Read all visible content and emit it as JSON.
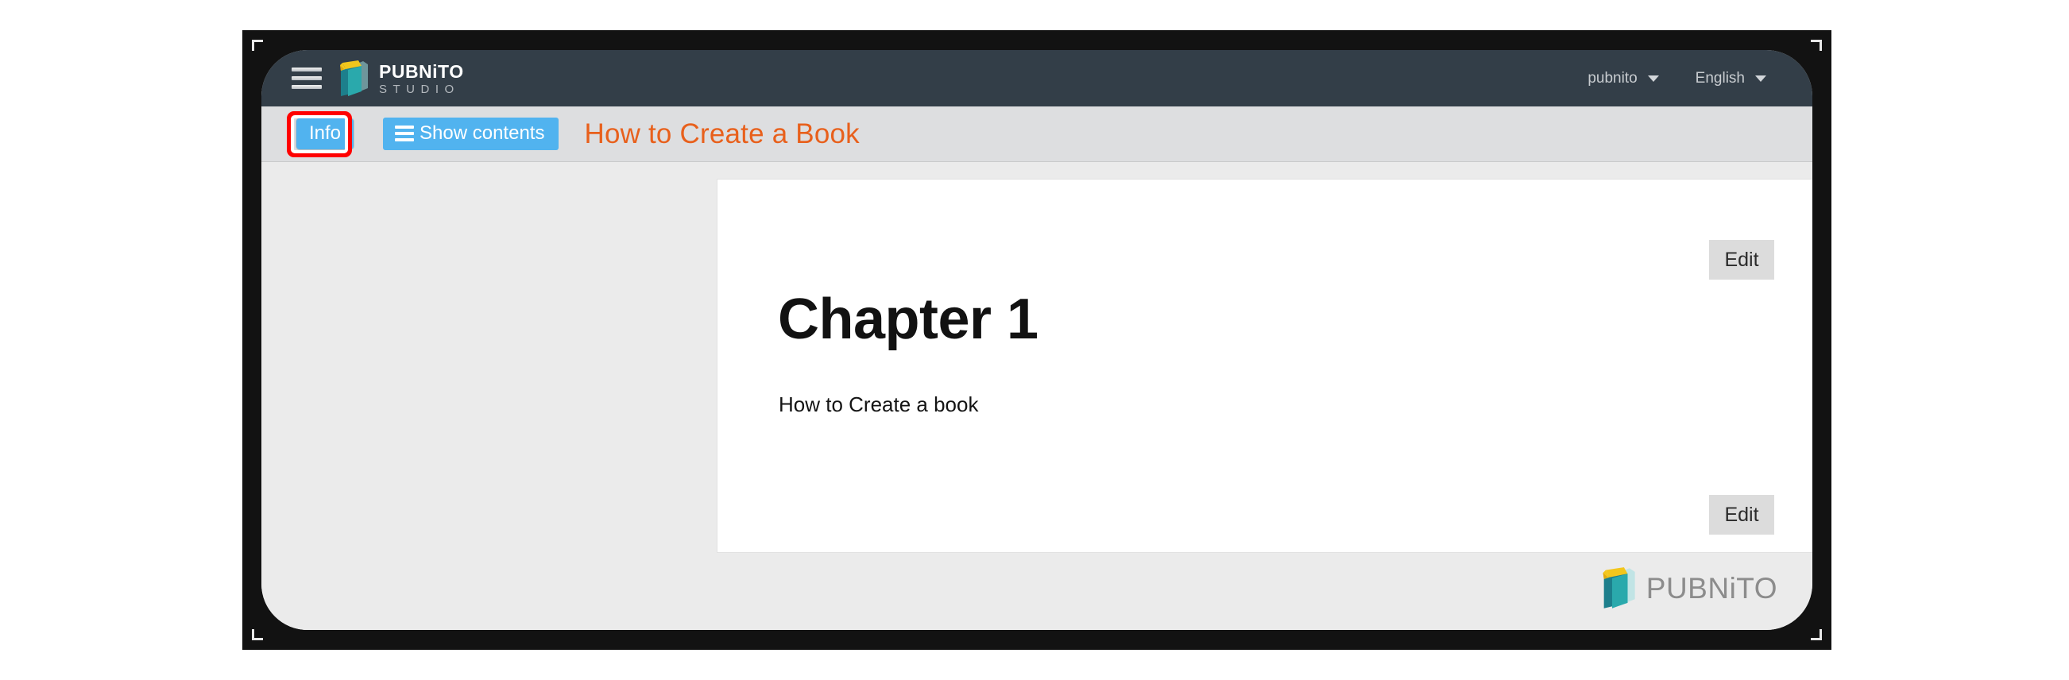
{
  "header": {
    "menu_icon": "hamburger-menu-icon",
    "brand": {
      "logo_icon": "pubnito-book-logo-icon",
      "name": "PUBNiTO",
      "subtitle": "STUDIO"
    },
    "account_menu": {
      "label": "pubnito",
      "caret_icon": "chevron-down-icon"
    },
    "language_menu": {
      "label": "English",
      "caret_icon": "chevron-down-icon"
    },
    "background_color": "#333e48"
  },
  "toolbar": {
    "info_button": "Info",
    "show_contents_button": "Show contents",
    "show_contents_icon": "list-lines-icon",
    "document_title": "How to Create a Book",
    "title_color": "#e8601c",
    "button_color": "#51b3ef",
    "background_color": "#dddee0",
    "highlight_color": "#ff0000"
  },
  "content": {
    "chapter_heading": "Chapter 1",
    "chapter_body": "How to Create a book",
    "edit_button_top": "Edit",
    "edit_button_bottom": "Edit"
  },
  "watermark": {
    "logo_icon": "pubnito-book-logo-icon",
    "text": "PUBNiTO",
    "text_color": "#8c8c8c"
  }
}
